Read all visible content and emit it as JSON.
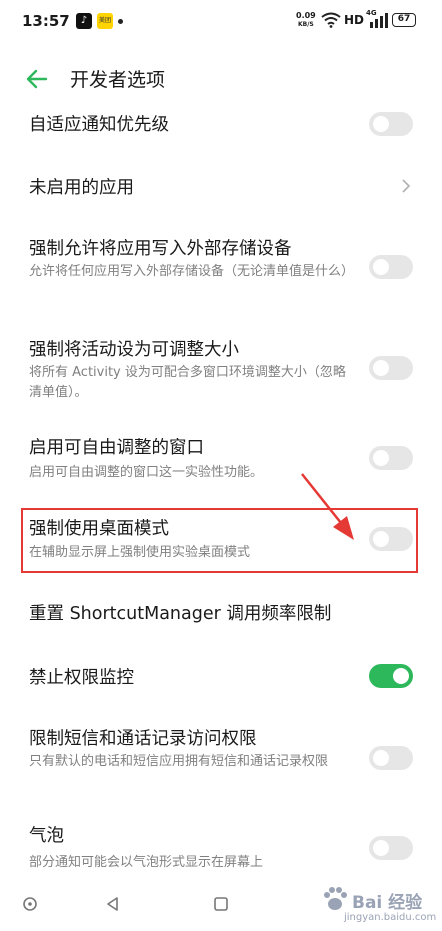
{
  "status_bar": {
    "time": "13:57",
    "app_icon_1": "♪",
    "app_icon_2": "美团",
    "net_speed_value": "0.09",
    "net_speed_unit": "KB/S",
    "hd_label": "HD",
    "signal_label": "4G",
    "battery_level": "67"
  },
  "header": {
    "back_icon": "arrow-left-icon",
    "title": "开发者选项"
  },
  "settings": {
    "items": [
      {
        "title": "自适应通知优先级",
        "subtitle": "",
        "control": "toggle",
        "state": "off"
      },
      {
        "title": "未启用的应用",
        "subtitle": "",
        "control": "chevron"
      },
      {
        "title": "强制允许将应用写入外部存储设备",
        "subtitle": "允许将任何应用写入外部存储设备（无论清单值是什么）",
        "control": "toggle",
        "state": "off"
      },
      {
        "title": "强制将活动设为可调整大小",
        "subtitle": "将所有 Activity 设为可配合多窗口环境调整大小（忽略清单值）。",
        "control": "toggle",
        "state": "off"
      },
      {
        "title": "启用可自由调整的窗口",
        "subtitle": "启用可自由调整的窗口这一实验性功能。",
        "control": "toggle",
        "state": "off"
      },
      {
        "title": "强制使用桌面模式",
        "subtitle": "在辅助显示屏上强制使用实验桌面模式",
        "control": "toggle",
        "state": "off",
        "highlighted": true
      },
      {
        "title": "重置 ShortcutManager 调用频率限制",
        "subtitle": "",
        "control": "none"
      },
      {
        "title": "禁止权限监控",
        "subtitle": "",
        "control": "toggle",
        "state": "on"
      },
      {
        "title": "限制短信和通话记录访问权限",
        "subtitle": "只有默认的电话和短信应用拥有短信和通话记录权限",
        "control": "toggle",
        "state": "off"
      },
      {
        "title": "气泡",
        "subtitle": "部分通知可能会以气泡形式显示在屏幕上",
        "control": "toggle",
        "state": "off"
      }
    ]
  },
  "colors": {
    "accent": "#2eb85c",
    "toggle_off": "#e6e6e6",
    "annotation_red": "#e53935",
    "subtitle_gray": "#808080"
  },
  "nav_bar": {
    "home": "home-circle-icon",
    "back": "back-triangle-icon",
    "recents": "recents-square-icon"
  },
  "watermark": {
    "text": "Bai 经验",
    "url": "jingyan.baidu.com"
  }
}
